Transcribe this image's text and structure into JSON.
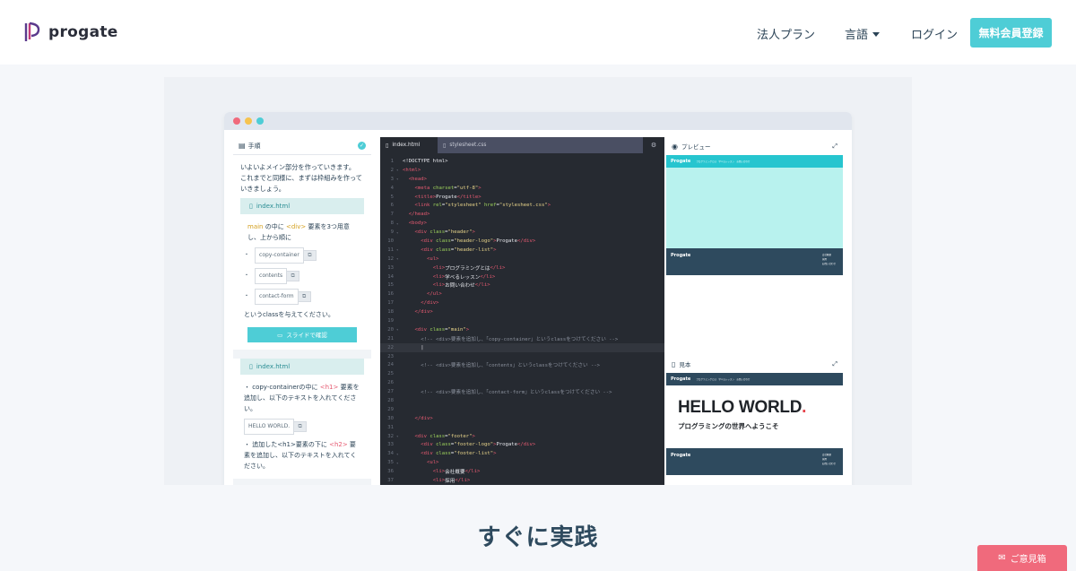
{
  "nav": {
    "logo_text": "progate",
    "links": {
      "corporate": "法人プラン",
      "language": "言語",
      "login": "ログイン"
    },
    "signup_label": "無料会員登録"
  },
  "steps": {
    "header": "手順",
    "intro": [
      "いよいよメイン部分を作っていきます。",
      "これまでと同様に、まずは枠組みを作っていきましょう。"
    ],
    "card1": {
      "file": "index.html",
      "line1_a": "main",
      "line1_b": " の中に ",
      "line1_c": "<div>",
      "line1_d": " 要素を3つ用意し、上から順に",
      "chips": [
        "copy-container",
        "contents",
        "contact-form"
      ],
      "after": "というclassを与えてください。",
      "slide_button": "スライドで確認"
    },
    "card2": {
      "file": "index.html",
      "line1_a": "・ copy-containerの中に ",
      "line1_b": "<h1>",
      "line1_c": " 要素を追加し、以下のテキストを入れてください。",
      "chip": "HELLO WORLD.",
      "line2_a": "・ 追加した<h1>要素の下に ",
      "line2_b": "<h2>",
      "line2_c": " 要素を追加し、以下のテキストを入れてください。"
    }
  },
  "editor": {
    "tabs": [
      "index.html",
      "stylesheet.css"
    ],
    "lines": [
      {
        "n": "1",
        "f": "",
        "segs": [
          [
            "pl",
            "<!DOCTYPE html>"
          ]
        ]
      },
      {
        "n": "2",
        "f": "▾",
        "segs": [
          [
            "tag",
            "<html>"
          ]
        ]
      },
      {
        "n": "3",
        "f": "▾",
        "segs": [
          [
            "pl",
            "  "
          ],
          [
            "tag",
            "<head>"
          ]
        ]
      },
      {
        "n": "4",
        "f": "",
        "segs": [
          [
            "pl",
            "    "
          ],
          [
            "tag",
            "<meta "
          ],
          [
            "attr",
            "charset"
          ],
          [
            "pl",
            "="
          ],
          [
            "str",
            "\"utf-8\""
          ],
          [
            "tag",
            ">"
          ]
        ]
      },
      {
        "n": "5",
        "f": "",
        "segs": [
          [
            "pl",
            "    "
          ],
          [
            "tag",
            "<title>"
          ],
          [
            "pl",
            "Progate"
          ],
          [
            "tag",
            "</title>"
          ]
        ]
      },
      {
        "n": "6",
        "f": "",
        "segs": [
          [
            "pl",
            "    "
          ],
          [
            "tag",
            "<link "
          ],
          [
            "attr",
            "rel"
          ],
          [
            "pl",
            "="
          ],
          [
            "str",
            "\"stylesheet\""
          ],
          [
            "pl",
            " "
          ],
          [
            "attr",
            "href"
          ],
          [
            "pl",
            "="
          ],
          [
            "str",
            "\"stylesheet.css\""
          ],
          [
            "tag",
            ">"
          ]
        ]
      },
      {
        "n": "7",
        "f": "",
        "segs": [
          [
            "pl",
            "  "
          ],
          [
            "tag",
            "</head>"
          ]
        ]
      },
      {
        "n": "8",
        "f": "▾",
        "segs": [
          [
            "pl",
            "  "
          ],
          [
            "tag",
            "<body>"
          ]
        ]
      },
      {
        "n": "9",
        "f": "▾",
        "segs": [
          [
            "pl",
            "    "
          ],
          [
            "tag",
            "<div "
          ],
          [
            "attr",
            "class"
          ],
          [
            "pl",
            "="
          ],
          [
            "str",
            "\"header\""
          ],
          [
            "tag",
            ">"
          ]
        ]
      },
      {
        "n": "10",
        "f": "",
        "segs": [
          [
            "pl",
            "      "
          ],
          [
            "tag",
            "<div "
          ],
          [
            "attr",
            "class"
          ],
          [
            "pl",
            "="
          ],
          [
            "str",
            "\"header-logo\""
          ],
          [
            "tag",
            ">"
          ],
          [
            "pl",
            "Progate"
          ],
          [
            "tag",
            "</div>"
          ]
        ]
      },
      {
        "n": "11",
        "f": "▾",
        "segs": [
          [
            "pl",
            "      "
          ],
          [
            "tag",
            "<div "
          ],
          [
            "attr",
            "class"
          ],
          [
            "pl",
            "="
          ],
          [
            "str",
            "\"header-list\""
          ],
          [
            "tag",
            ">"
          ]
        ]
      },
      {
        "n": "12",
        "f": "▾",
        "segs": [
          [
            "pl",
            "        "
          ],
          [
            "tag",
            "<ul>"
          ]
        ]
      },
      {
        "n": "13",
        "f": "",
        "segs": [
          [
            "pl",
            "          "
          ],
          [
            "tag",
            "<li>"
          ],
          [
            "pl",
            "プログラミングとは"
          ],
          [
            "tag",
            "</li>"
          ]
        ]
      },
      {
        "n": "14",
        "f": "",
        "segs": [
          [
            "pl",
            "          "
          ],
          [
            "tag",
            "<li>"
          ],
          [
            "pl",
            "学べるレッスン"
          ],
          [
            "tag",
            "</li>"
          ]
        ]
      },
      {
        "n": "15",
        "f": "",
        "segs": [
          [
            "pl",
            "          "
          ],
          [
            "tag",
            "<li>"
          ],
          [
            "pl",
            "お問い合わせ"
          ],
          [
            "tag",
            "</li>"
          ]
        ]
      },
      {
        "n": "16",
        "f": "",
        "segs": [
          [
            "pl",
            "        "
          ],
          [
            "tag",
            "</ul>"
          ]
        ]
      },
      {
        "n": "17",
        "f": "",
        "segs": [
          [
            "pl",
            "      "
          ],
          [
            "tag",
            "</div>"
          ]
        ]
      },
      {
        "n": "18",
        "f": "",
        "segs": [
          [
            "pl",
            "    "
          ],
          [
            "tag",
            "</div>"
          ]
        ]
      },
      {
        "n": "19",
        "f": "",
        "segs": [
          [
            "pl",
            ""
          ]
        ]
      },
      {
        "n": "20",
        "f": "▾",
        "segs": [
          [
            "pl",
            "    "
          ],
          [
            "tag",
            "<div "
          ],
          [
            "attr",
            "class"
          ],
          [
            "pl",
            "="
          ],
          [
            "str",
            "\"main\""
          ],
          [
            "tag",
            ">"
          ]
        ]
      },
      {
        "n": "21",
        "f": "",
        "segs": [
          [
            "pl",
            "      "
          ],
          [
            "com",
            "<!-- <div>要素を追加し、「copy-container」というclassをつけてください -->"
          ]
        ]
      },
      {
        "n": "22",
        "f": "",
        "cur": true,
        "segs": [
          [
            "pl",
            "      |"
          ]
        ]
      },
      {
        "n": "23",
        "f": "",
        "segs": [
          [
            "pl",
            ""
          ]
        ]
      },
      {
        "n": "24",
        "f": "",
        "segs": [
          [
            "pl",
            "      "
          ],
          [
            "com",
            "<!-- <div>要素を追加し、「contents」というclassをつけてください -->"
          ]
        ]
      },
      {
        "n": "25",
        "f": "",
        "segs": [
          [
            "pl",
            ""
          ]
        ]
      },
      {
        "n": "26",
        "f": "",
        "segs": [
          [
            "pl",
            ""
          ]
        ]
      },
      {
        "n": "27",
        "f": "",
        "segs": [
          [
            "pl",
            "      "
          ],
          [
            "com",
            "<!-- <div>要素を追加し、「contact-form」というclassをつけてください -->"
          ]
        ]
      },
      {
        "n": "28",
        "f": "",
        "segs": [
          [
            "pl",
            ""
          ]
        ]
      },
      {
        "n": "29",
        "f": "",
        "segs": [
          [
            "pl",
            ""
          ]
        ]
      },
      {
        "n": "30",
        "f": "",
        "segs": [
          [
            "pl",
            "    "
          ],
          [
            "tag",
            "</div>"
          ]
        ]
      },
      {
        "n": "31",
        "f": "",
        "segs": [
          [
            "pl",
            ""
          ]
        ]
      },
      {
        "n": "32",
        "f": "▾",
        "segs": [
          [
            "pl",
            "    "
          ],
          [
            "tag",
            "<div "
          ],
          [
            "attr",
            "class"
          ],
          [
            "pl",
            "="
          ],
          [
            "str",
            "\"footer\""
          ],
          [
            "tag",
            ">"
          ]
        ]
      },
      {
        "n": "33",
        "f": "",
        "segs": [
          [
            "pl",
            "      "
          ],
          [
            "tag",
            "<div "
          ],
          [
            "attr",
            "class"
          ],
          [
            "pl",
            "="
          ],
          [
            "str",
            "\"footer-logo\""
          ],
          [
            "tag",
            ">"
          ],
          [
            "pl",
            "Progate"
          ],
          [
            "tag",
            "</div>"
          ]
        ]
      },
      {
        "n": "34",
        "f": "▾",
        "segs": [
          [
            "pl",
            "      "
          ],
          [
            "tag",
            "<div "
          ],
          [
            "attr",
            "class"
          ],
          [
            "pl",
            "="
          ],
          [
            "str",
            "\"footer-list\""
          ],
          [
            "tag",
            ">"
          ]
        ]
      },
      {
        "n": "35",
        "f": "▾",
        "segs": [
          [
            "pl",
            "        "
          ],
          [
            "tag",
            "<ul>"
          ]
        ]
      },
      {
        "n": "36",
        "f": "",
        "segs": [
          [
            "pl",
            "          "
          ],
          [
            "tag",
            "<li>"
          ],
          [
            "pl",
            "会社概要"
          ],
          [
            "tag",
            "</li>"
          ]
        ]
      },
      {
        "n": "37",
        "f": "",
        "segs": [
          [
            "pl",
            "          "
          ],
          [
            "tag",
            "<li>"
          ],
          [
            "pl",
            "採用"
          ],
          [
            "tag",
            "</li>"
          ]
        ]
      }
    ]
  },
  "preview": {
    "header": "プレビュー",
    "logo": "Progate",
    "nav_items": "プログラミングとは　学べるレッスン　お問い合わせ",
    "footer_logo": "Progate",
    "footer_items": [
      "会社概要",
      "採用",
      "お問い合わせ"
    ]
  },
  "sample": {
    "header": "見本",
    "logo": "Progate",
    "nav_items": "プログラミングとは　学べるレッスン　お問い合わせ",
    "hello": "HELLO WORLD",
    "hello_dot": ".",
    "subtitle": "プログラミングの世界へようこそ",
    "footer_logo": "Progate",
    "footer_items": [
      "会社概要",
      "採用",
      "お問い合わせ"
    ]
  },
  "section_title": "すぐに実践",
  "feedback_label": "ご意見箱",
  "colors": {
    "accent": "#4ecdd6",
    "navy": "#2e4a5e",
    "feedback": "#f06a7c"
  }
}
